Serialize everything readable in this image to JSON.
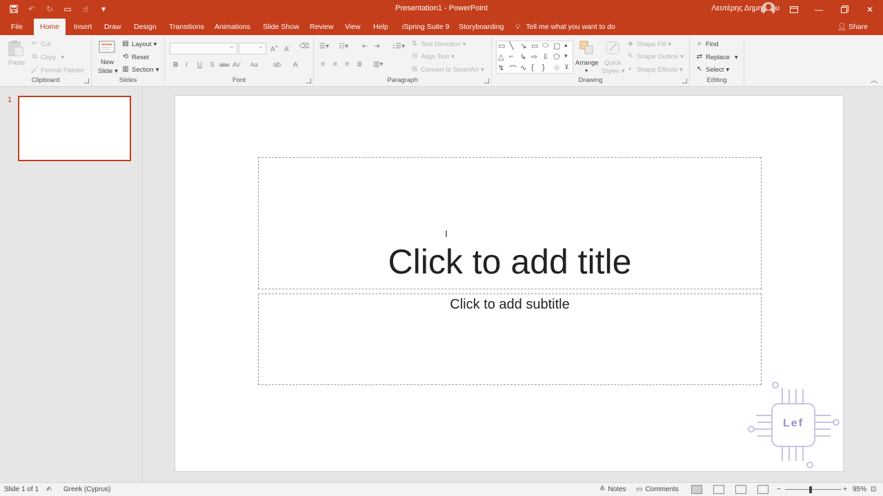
{
  "window": {
    "title": "Presentation1  -  PowerPoint",
    "user": "Λευτέρης Δημητρίου"
  },
  "tabs": [
    "File",
    "Home",
    "Insert",
    "Draw",
    "Design",
    "Transitions",
    "Animations",
    "Slide Show",
    "Review",
    "View",
    "Help",
    "iSpring Suite 9",
    "Storyboarding"
  ],
  "active_tab": "Home",
  "tell_me": "Tell me what you want to do",
  "share": "Share",
  "ribbon": {
    "clipboard": {
      "label": "Clipboard",
      "paste": "Paste",
      "cut": "Cut",
      "copy": "Copy",
      "format_painter": "Format Painter"
    },
    "slides": {
      "label": "Slides",
      "new_slide_line1": "New",
      "new_slide_line2": "Slide",
      "layout": "Layout",
      "reset": "Reset",
      "section": "Section"
    },
    "font": {
      "label": "Font",
      "bold": "B",
      "italic": "I",
      "underline": "U",
      "shadow": "S",
      "strikethrough": "abc",
      "spacing": "AV",
      "case": "Aa",
      "font_color": "A"
    },
    "paragraph": {
      "label": "Paragraph",
      "text_direction": "Text Direction",
      "align_text": "Align Text",
      "convert_smartart": "Convert to SmartArt"
    },
    "drawing": {
      "label": "Drawing",
      "arrange": "Arrange",
      "quick_styles_line1": "Quick",
      "quick_styles_line2": "Styles",
      "shape_fill": "Shape Fill",
      "shape_outline": "Shape Outline",
      "shape_effects": "Shape Effects"
    },
    "editing": {
      "label": "Editing",
      "find": "Find",
      "replace": "Replace",
      "select": "Select"
    }
  },
  "thumbnails": [
    {
      "number": "1"
    }
  ],
  "slide": {
    "title_placeholder": "Click to add title",
    "subtitle_placeholder": "Click to add subtitle",
    "logo_text": "Lef"
  },
  "status": {
    "slide_info": "Slide 1 of 1",
    "language": "Greek (Cyprus)",
    "notes": "Notes",
    "comments": "Comments",
    "zoom": "95%"
  },
  "colors": {
    "accent": "#c43e1c",
    "ribbon_bg": "#f3f3f3",
    "editor_bg": "#e6e6e6"
  }
}
